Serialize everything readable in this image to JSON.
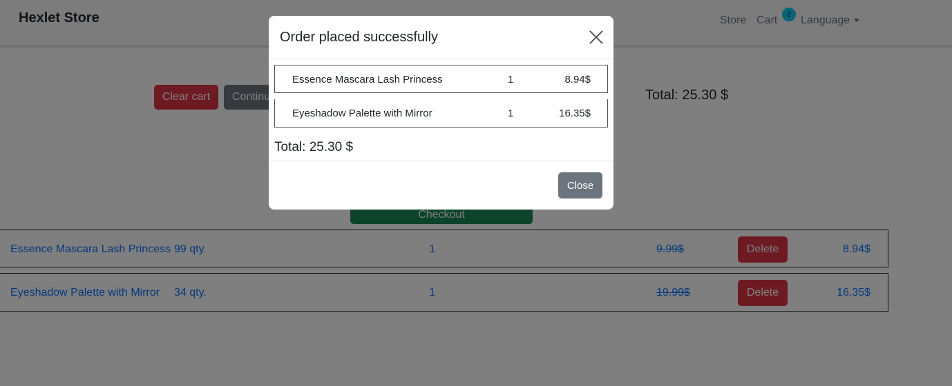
{
  "navbar": {
    "brand": "Hexlet Store",
    "store_link": "Store",
    "cart_link": "Cart",
    "cart_badge": "2",
    "language_link": "Language"
  },
  "cart": {
    "clear_label": "Clear cart",
    "continue_label": "Continue shopping",
    "total": "Total: 25.30 $",
    "checkout_label": "Checkout",
    "items": [
      {
        "name": "Essence Mascara Lash Princess",
        "stock": "99 qty.",
        "count": "1",
        "old_price": "9.99$",
        "delete_label": "Delete",
        "price": "8.94$"
      },
      {
        "name": "Eyeshadow Palette with Mirror",
        "stock": "34 qty.",
        "count": "1",
        "old_price": "19.99$",
        "delete_label": "Delete",
        "price": "16.35$"
      }
    ]
  },
  "modal": {
    "title": "Order placed successfully",
    "items": [
      {
        "name": "Essence Mascara Lash Princess",
        "count": "1",
        "price": "8.94$"
      },
      {
        "name": "Eyeshadow Palette with Mirror",
        "count": "1",
        "price": "16.35$"
      }
    ],
    "total": "Total: 25.30 $",
    "close_label": "Close"
  },
  "colors": {
    "danger": "#dc3545",
    "secondary": "#6c757d",
    "success": "#198754",
    "link": "#0d6efd",
    "badge": "#0dcaf0"
  }
}
